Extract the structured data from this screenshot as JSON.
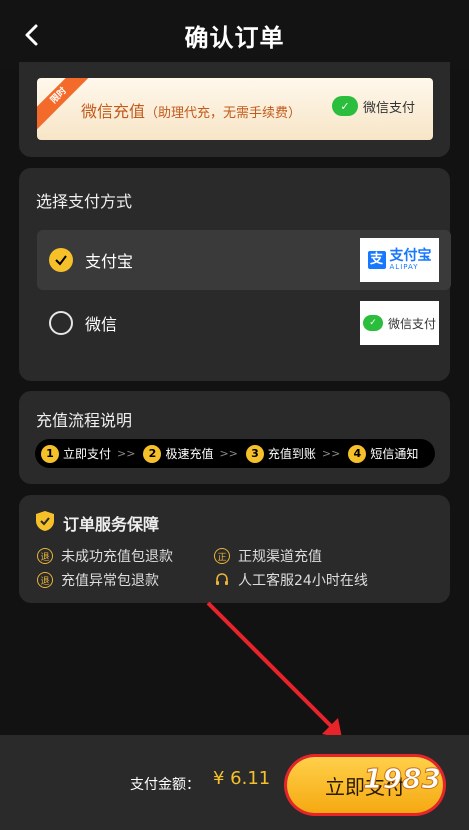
{
  "header": {
    "title": "确认订单"
  },
  "banner": {
    "ribbon": "限时",
    "title": "微信充值",
    "subtitle": "（助理代充，无需手续费）",
    "pay_label": "微信支付"
  },
  "payment": {
    "section_title": "选择支付方式",
    "options": [
      {
        "label": "支付宝",
        "selected": true,
        "logo_text": "支付宝",
        "logo_sub": "ALIPAY"
      },
      {
        "label": "微信",
        "selected": false,
        "logo_text": "微信支付"
      }
    ]
  },
  "flow": {
    "title": "充值流程说明",
    "steps": [
      {
        "num": "1",
        "label": "立即支付"
      },
      {
        "num": "2",
        "label": "极速充值"
      },
      {
        "num": "3",
        "label": "充值到账"
      },
      {
        "num": "4",
        "label": "短信通知"
      }
    ],
    "arrow": ">>"
  },
  "service": {
    "title": "订单服务保障",
    "items": [
      {
        "icon": "退",
        "label": "未成功充值包退款"
      },
      {
        "icon": "正",
        "label": "正规渠道充值"
      },
      {
        "icon": "退",
        "label": "充值异常包退款"
      },
      {
        "icon": "headset-icon",
        "label": "人工客服24小时在线"
      }
    ]
  },
  "footer": {
    "amount_label": "支付金额：",
    "amount_value": "¥ 6.11",
    "pay_button": "立即支付"
  },
  "watermark": "1983",
  "colors": {
    "accent": "#f6c02b",
    "alipay": "#1677ff",
    "wechat": "#2bbd3c",
    "annotation": "#e8242a"
  }
}
